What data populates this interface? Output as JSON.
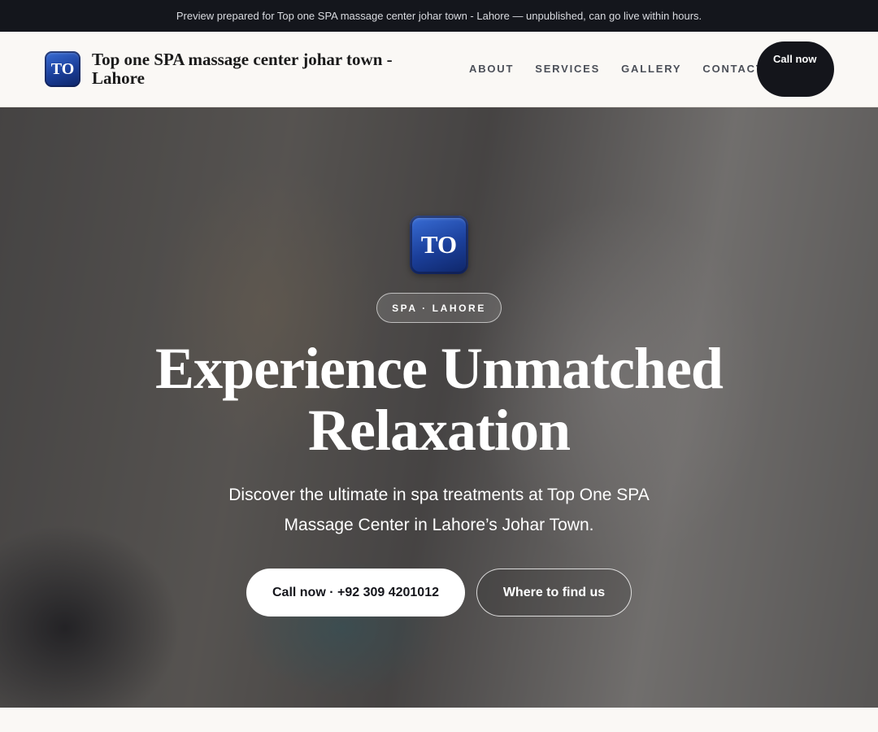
{
  "preview_banner": "Preview prepared for Top one SPA massage center johar town - Lahore — unpublished, can go live within hours.",
  "header": {
    "logo_initials": "TO",
    "site_name": "Top one SPA massage center johar town - Lahore",
    "nav": [
      "ABOUT",
      "SERVICES",
      "GALLERY",
      "CONTACT"
    ],
    "call_button": "Call now"
  },
  "hero": {
    "logo_initials": "TO",
    "tag": "SPA · LAHORE",
    "title": "Experience Unmatched Relaxation",
    "subtitle": "Discover the ultimate in spa treatments at Top One SPA Massage Center in Lahore’s Johar Town.",
    "primary_cta": "Call now · +92 309 4201012",
    "secondary_cta": "Where to find us"
  },
  "colors": {
    "brand_blue": "#1b3f9a",
    "dark": "#14151b",
    "background": "#faf8f5"
  }
}
